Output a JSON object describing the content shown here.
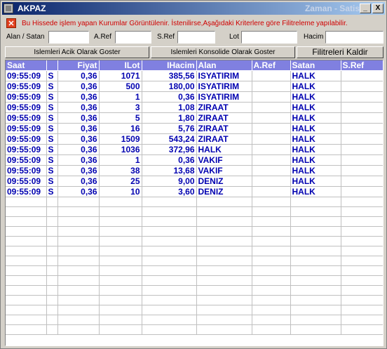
{
  "window": {
    "title": "AKPAZ",
    "mode": "Zaman - Satis",
    "minimize_label": "_",
    "close_label": "X"
  },
  "notice": {
    "icon": "close-icon",
    "text": "Bu Hissede işlem yapan Kurumlar Görüntülenir. İstenilirse,Aşağıdaki Kriterlere göre Filitreleme yapılabilir."
  },
  "filters": {
    "alan_satan": {
      "label": "Alan / Satan",
      "value": ""
    },
    "a_ref": {
      "label": "A.Ref",
      "value": ""
    },
    "s_ref": {
      "label": "S.Ref",
      "value": ""
    },
    "lot": {
      "label": "Lot",
      "value": ""
    },
    "hacim": {
      "label": "Hacim",
      "value": ""
    }
  },
  "buttons": {
    "acik": "Islemleri Acik Olarak Goster",
    "konsolide": "Islemleri Konsolide Olarak Goster",
    "kaldir": "Filitreleri Kaldir"
  },
  "table": {
    "columns": [
      "Saat",
      "",
      "Fiyat",
      "ILot",
      "IHacim",
      "Alan",
      "A.Ref",
      "Satan",
      "S.Ref"
    ],
    "rows": [
      [
        "09:55:09",
        "S",
        "0,36",
        "1071",
        "385,56",
        "ISYATIRIM",
        "",
        "HALK",
        ""
      ],
      [
        "09:55:09",
        "S",
        "0,36",
        "500",
        "180,00",
        "ISYATIRIM",
        "",
        "HALK",
        ""
      ],
      [
        "09:55:09",
        "S",
        "0,36",
        "1",
        "0,36",
        "ISYATIRIM",
        "",
        "HALK",
        ""
      ],
      [
        "09:55:09",
        "S",
        "0,36",
        "3",
        "1,08",
        "ZIRAAT",
        "",
        "HALK",
        ""
      ],
      [
        "09:55:09",
        "S",
        "0,36",
        "5",
        "1,80",
        "ZIRAAT",
        "",
        "HALK",
        ""
      ],
      [
        "09:55:09",
        "S",
        "0,36",
        "16",
        "5,76",
        "ZIRAAT",
        "",
        "HALK",
        ""
      ],
      [
        "09:55:09",
        "S",
        "0,36",
        "1509",
        "543,24",
        "ZIRAAT",
        "",
        "HALK",
        ""
      ],
      [
        "09:55:09",
        "S",
        "0,36",
        "1036",
        "372,96",
        "HALK",
        "",
        "HALK",
        ""
      ],
      [
        "09:55:09",
        "S",
        "0,36",
        "1",
        "0,36",
        "VAKIF",
        "",
        "HALK",
        ""
      ],
      [
        "09:55:09",
        "S",
        "0,36",
        "38",
        "13,68",
        "VAKIF",
        "",
        "HALK",
        ""
      ],
      [
        "09:55:09",
        "S",
        "0,36",
        "25",
        "9,00",
        "DENIZ",
        "",
        "HALK",
        ""
      ],
      [
        "09:55:09",
        "S",
        "0,36",
        "10",
        "3,60",
        "DENIZ",
        "",
        "HALK",
        ""
      ]
    ]
  }
}
